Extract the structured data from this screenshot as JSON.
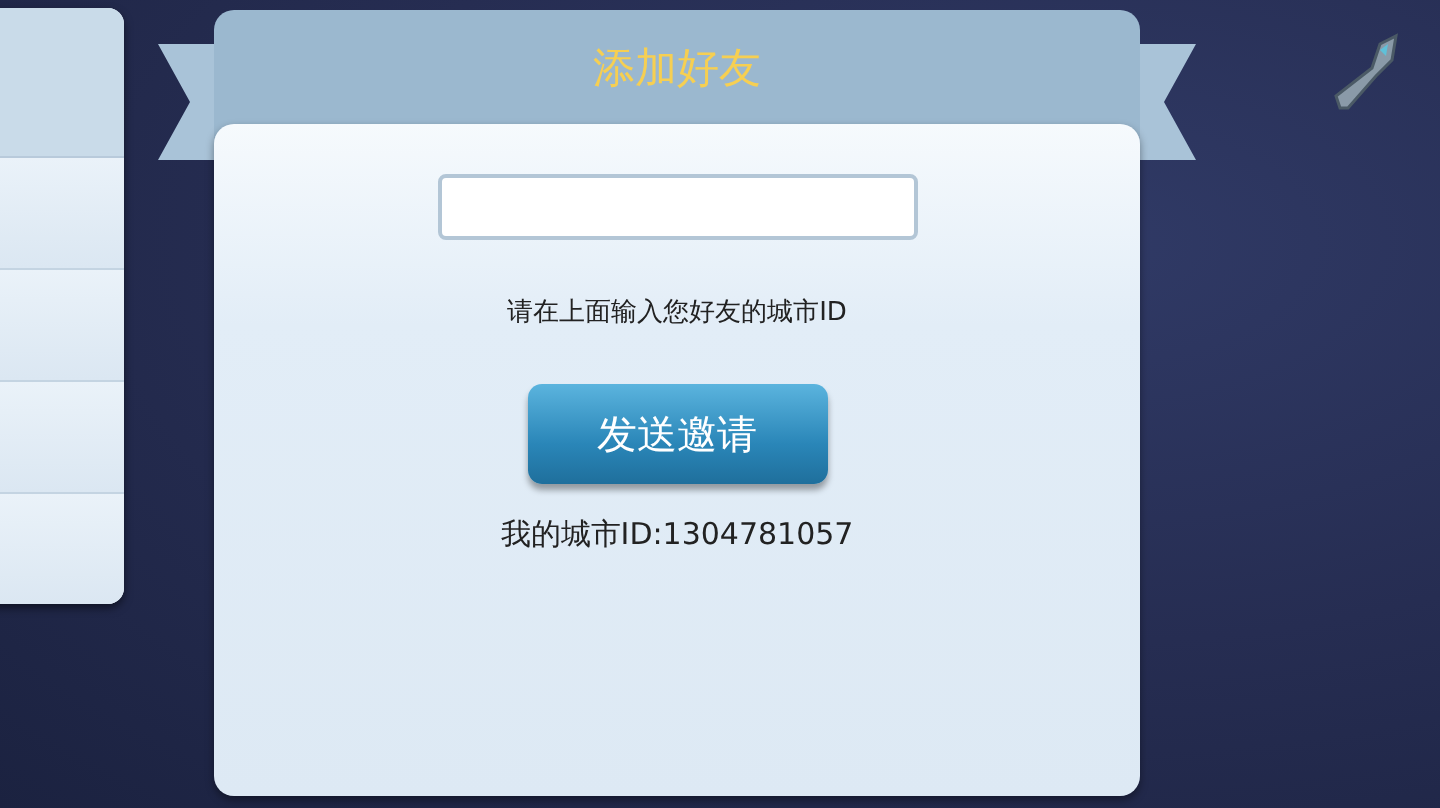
{
  "dialog": {
    "title": "添加好友",
    "hint": "请在上面输入您好友的城市ID",
    "button": "发送邀请",
    "city_id": "我的城市ID:1304781057"
  }
}
